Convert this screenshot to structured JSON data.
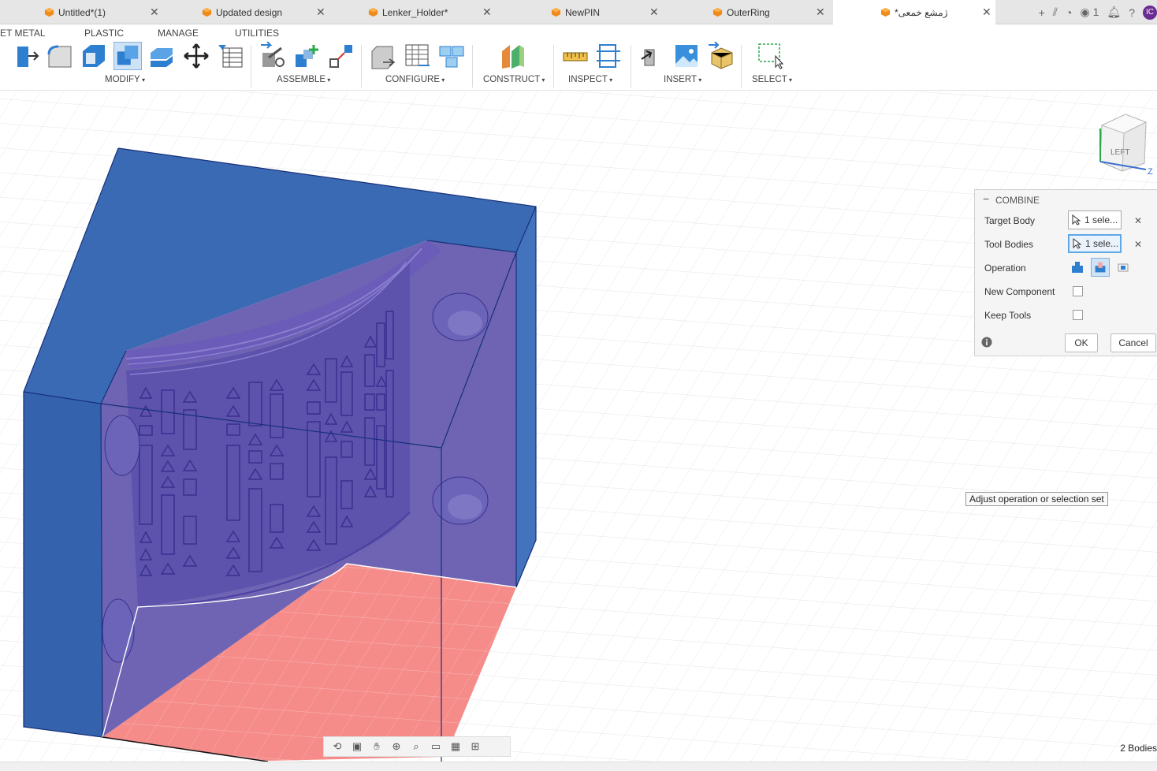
{
  "tabs": [
    {
      "label": "Untitled*(1)",
      "active": false
    },
    {
      "label": "Updated design",
      "active": false
    },
    {
      "label": "Lenker_Holder*",
      "active": false
    },
    {
      "label": "NewPIN",
      "active": false
    },
    {
      "label": "OuterRing",
      "active": false
    },
    {
      "label": "*ژمشع خمعی",
      "active": true
    }
  ],
  "topbar": {
    "job_count": "1",
    "avatar_initials": "IC"
  },
  "ribbon": {
    "tabs": [
      "ET METAL",
      "PLASTIC",
      "MANAGE",
      "UTILITIES"
    ],
    "groups": {
      "modify": "MODIFY",
      "assemble": "ASSEMBLE",
      "configure": "CONFIGURE",
      "construct": "CONSTRUCT",
      "inspect": "INSPECT",
      "insert": "INSERT",
      "select": "SELECT"
    }
  },
  "viewcube": {
    "face_label": "LEFT",
    "axis_z": "Z"
  },
  "combine_panel": {
    "title": "COMBINE",
    "target_body_label": "Target Body",
    "target_body_value": "1 sele...",
    "tool_bodies_label": "Tool Bodies",
    "tool_bodies_value": "1 sele...",
    "operation_label": "Operation",
    "new_component_label": "New Component",
    "new_component_checked": false,
    "keep_tools_label": "Keep Tools",
    "keep_tools_checked": false,
    "ok_label": "OK",
    "cancel_label": "Cancel"
  },
  "tooltip": "Adjust operation or selection set",
  "status": {
    "bodies": "2 Bodies"
  },
  "colors": {
    "body_blue": "#3a66b0",
    "body_purple": "#5a4fa8",
    "floor_pink": "#f58c8a",
    "accent": "#5fa8e8"
  }
}
